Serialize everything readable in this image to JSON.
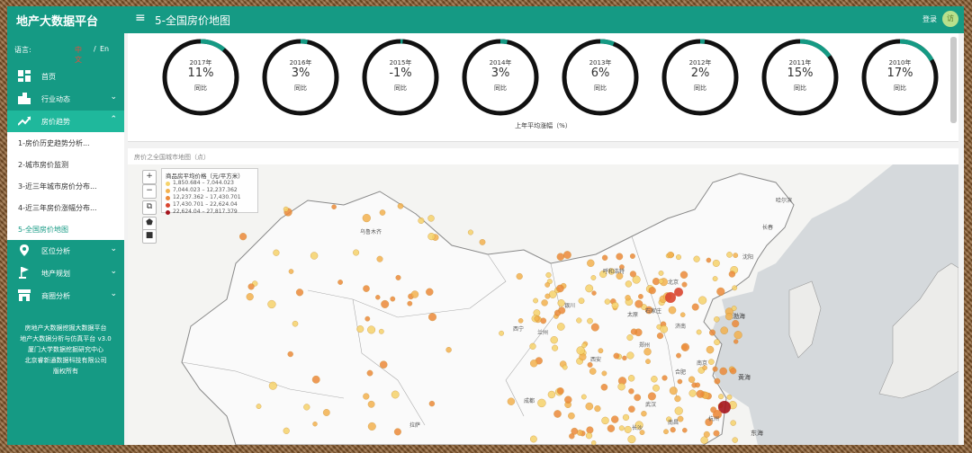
{
  "app": {
    "brand": "地产大数据平台",
    "page_title": "5-全国房价地图",
    "login": "登录",
    "avatar_text": "访"
  },
  "lang": {
    "label": "语言:",
    "zh": "中文",
    "sep": "/",
    "en": "En"
  },
  "sidebar": {
    "items": [
      {
        "label": "首页",
        "icon": "dashboard-icon"
      },
      {
        "label": "行业动态",
        "icon": "buildings-icon"
      },
      {
        "label": "房价趋势",
        "icon": "trend-up-icon"
      },
      {
        "label": "区位分析",
        "icon": "location-pin-icon"
      },
      {
        "label": "地产规划",
        "icon": "golf-flag-icon"
      },
      {
        "label": "商圈分析",
        "icon": "store-icon"
      }
    ],
    "sub_items": [
      {
        "label": "1-房价历史趋势分析..."
      },
      {
        "label": "2-城市房价监测"
      },
      {
        "label": "3-近三年城市房价分布..."
      },
      {
        "label": "4-近三年房价涨幅分布..."
      },
      {
        "label": "5-全国房价地图"
      }
    ],
    "footer": [
      "房地产大数据挖掘大数据平台",
      "地产大数据分析与仿真平台 v3.0",
      "厦门大学数据挖掘研究中心",
      "北京睿新通数据科技有限公司",
      "版权所有"
    ]
  },
  "gauges": [
    {
      "year": "2017年",
      "value": "11%",
      "yoy": "同比",
      "pct": 0.11
    },
    {
      "year": "2016年",
      "value": "3%",
      "yoy": "同比",
      "pct": 0.03
    },
    {
      "year": "2015年",
      "value": "-1%",
      "yoy": "同比",
      "pct": 0.01
    },
    {
      "year": "2014年",
      "value": "3%",
      "yoy": "同比",
      "pct": 0.03
    },
    {
      "year": "2013年",
      "value": "6%",
      "yoy": "同比",
      "pct": 0.06
    },
    {
      "year": "2012年",
      "value": "2%",
      "yoy": "同比",
      "pct": 0.02
    },
    {
      "year": "2011年",
      "value": "15%",
      "yoy": "同比",
      "pct": 0.15
    },
    {
      "year": "2010年",
      "value": "17%",
      "yoy": "同比",
      "pct": 0.17
    }
  ],
  "gauge_caption": "上年平均涨幅（%）",
  "map": {
    "title": "房价之全国城市地图（点）",
    "controls": [
      "+",
      "−",
      "⧉",
      "⬟",
      "■"
    ],
    "legend_title": "商品房平均价格（元/平方米）",
    "legend": [
      {
        "label": "1,850.684 – 7,044.023",
        "color": "#f6d36b"
      },
      {
        "label": "7,044.023 – 12,237.362",
        "color": "#f3b24f"
      },
      {
        "label": "12,237.362 – 17,430.701",
        "color": "#ec8a3a"
      },
      {
        "label": "17,430.701 – 22,624.04",
        "color": "#d9452f"
      },
      {
        "label": "22,624.04 – 27,817.379",
        "color": "#a5141c"
      }
    ],
    "cities": [
      "乌鲁木齐",
      "哈尔滨",
      "长春",
      "沈阳",
      "呼和浩特",
      "北京",
      "石家庄",
      "太原",
      "济南",
      "银川",
      "兰州",
      "西宁",
      "西安",
      "郑州",
      "合肥",
      "南京",
      "武汉",
      "杭州",
      "拉萨",
      "长沙",
      "南昌",
      "成都"
    ],
    "seas": [
      "渤海",
      "黄海",
      "东海"
    ]
  }
}
